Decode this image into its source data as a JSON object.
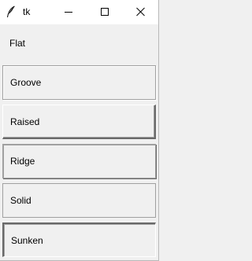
{
  "window": {
    "title": "tk",
    "icon": "feather-icon",
    "controls": {
      "minimize": "minimize-icon",
      "maximize": "maximize-icon",
      "close": "close-icon"
    }
  },
  "labels": [
    {
      "text": "Flat"
    },
    {
      "text": "Groove"
    },
    {
      "text": "Raised"
    },
    {
      "text": "Ridge"
    },
    {
      "text": "Solid"
    },
    {
      "text": "Sunken"
    }
  ],
  "colors": {
    "titlebar_bg": "#ffffff",
    "client_bg": "#f0f0f0",
    "border_dark": "#696969",
    "border_mid": "#a0a0a0",
    "border_light": "#ffffff"
  }
}
